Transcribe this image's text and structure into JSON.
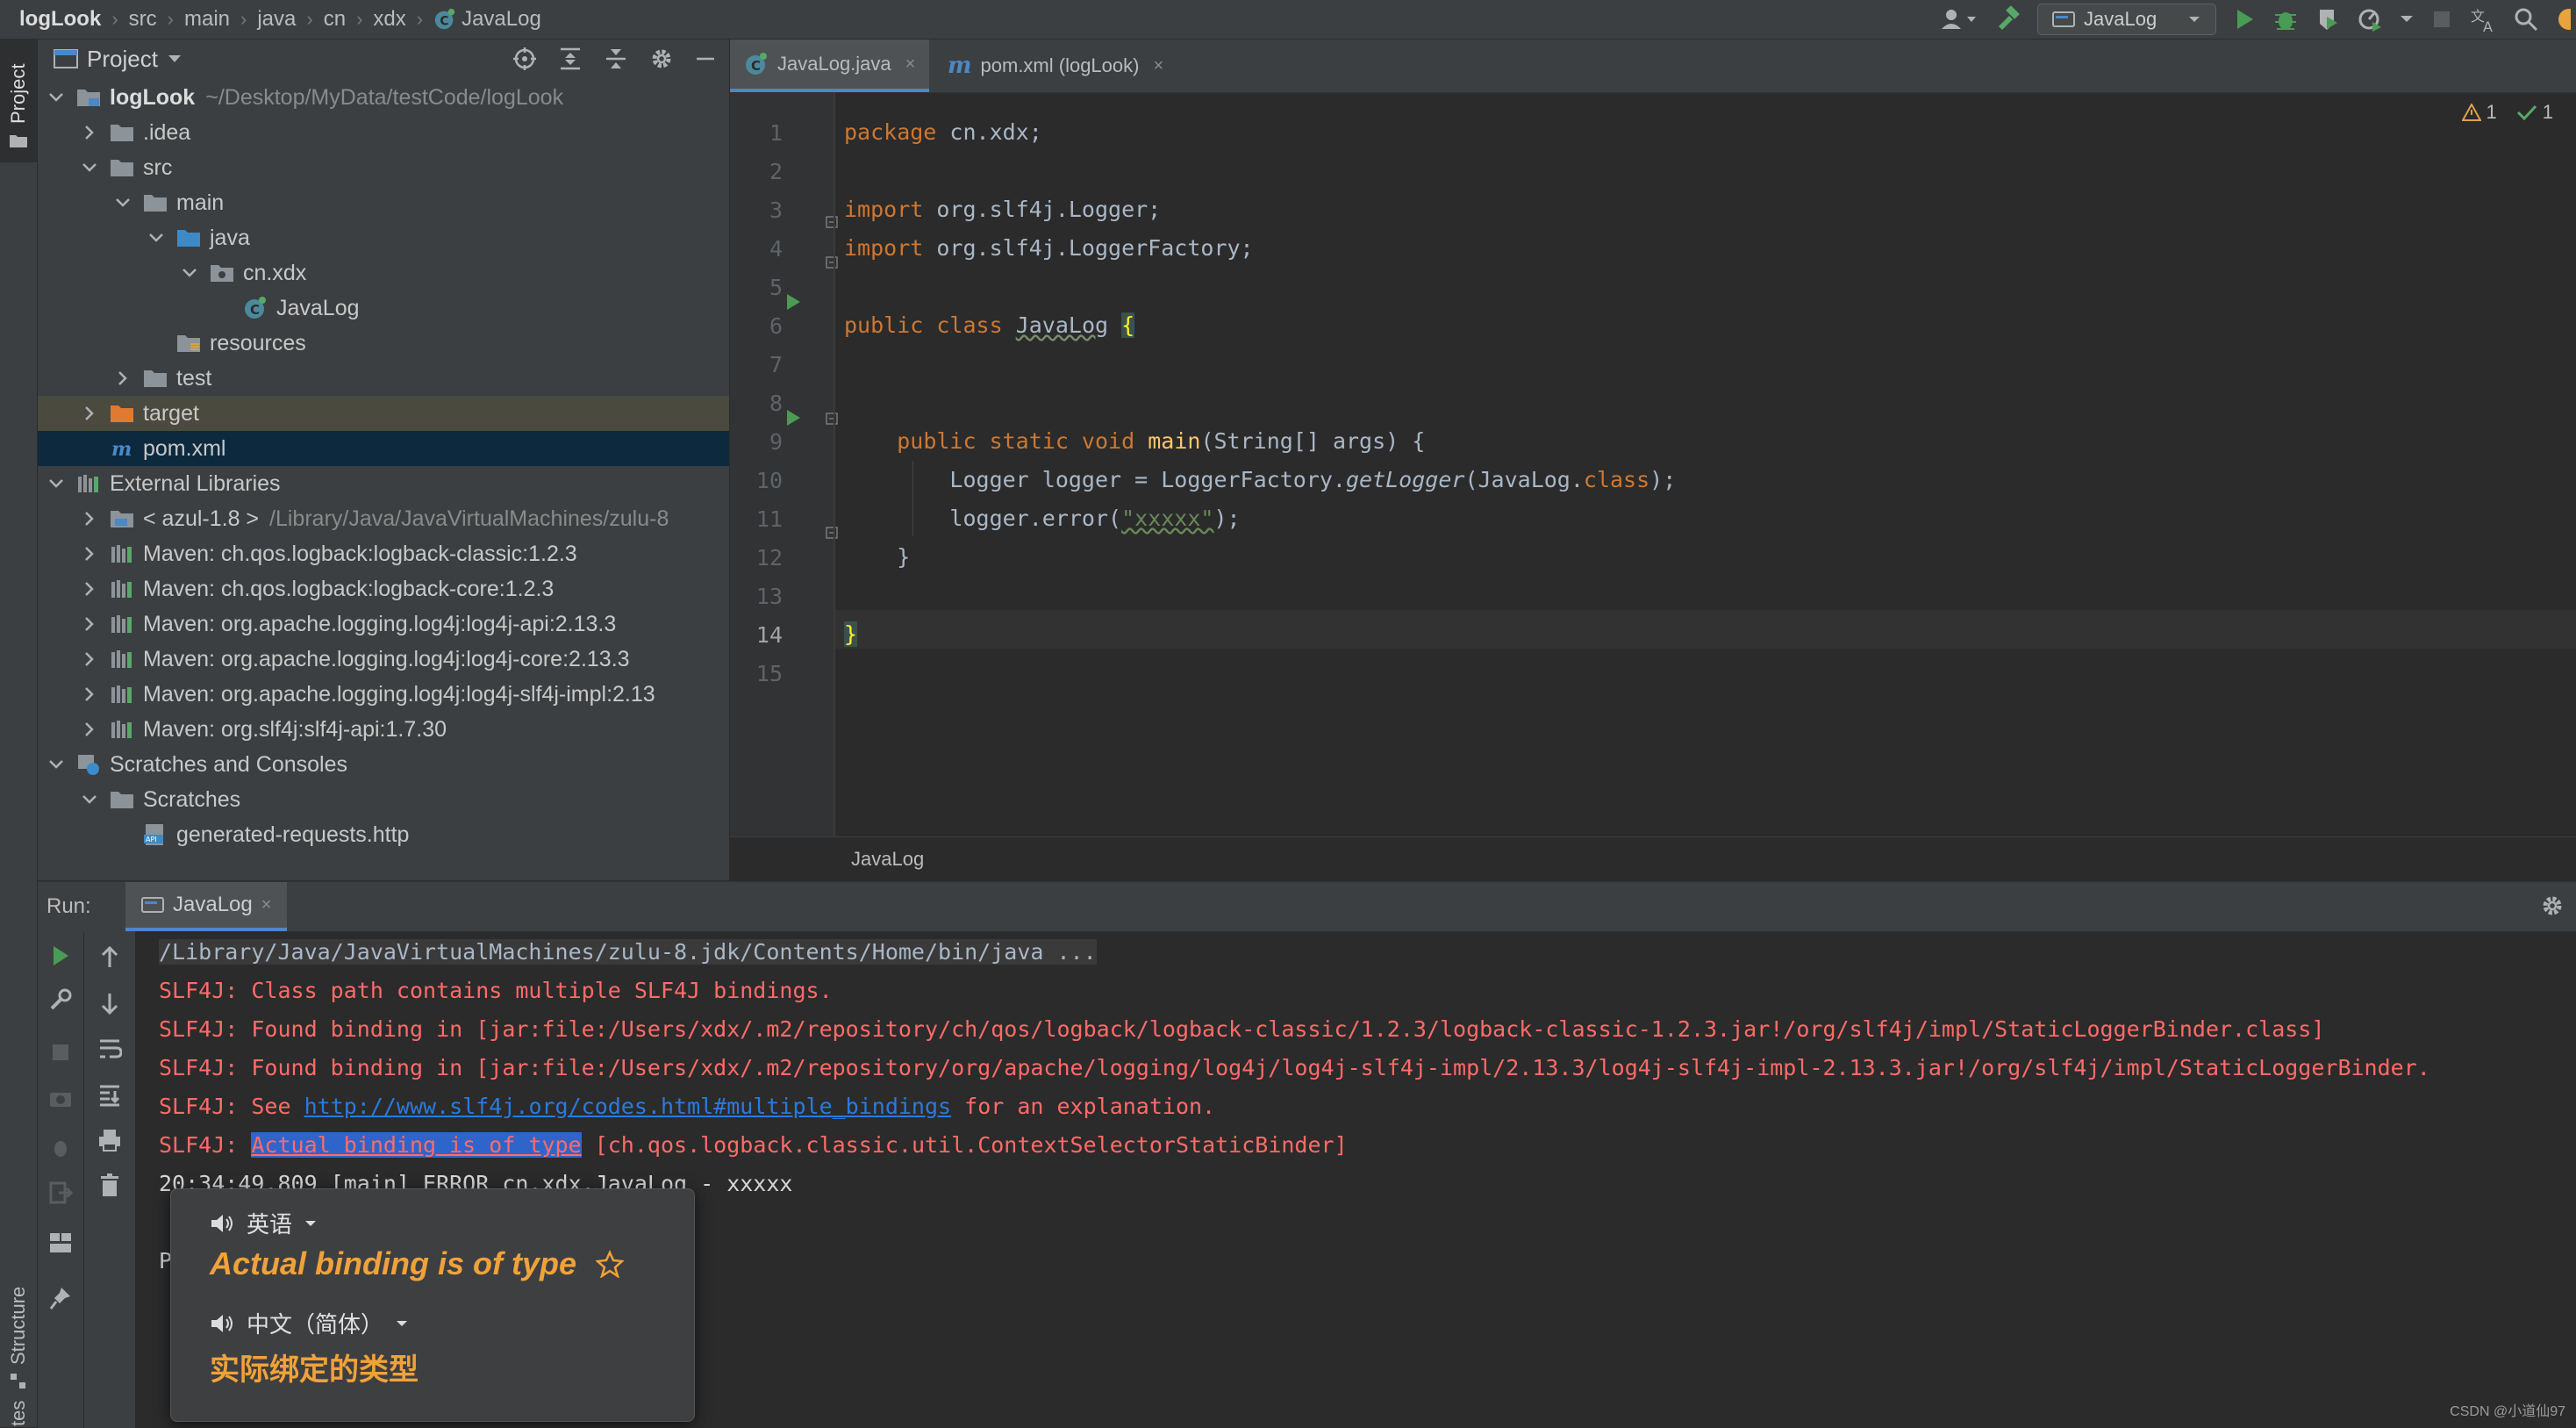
{
  "navbar": {
    "breadcrumbs": [
      "logLook",
      "src",
      "main",
      "java",
      "cn",
      "xdx",
      "JavaLog"
    ],
    "run_config": "JavaLog"
  },
  "left_stripe": {
    "project_tab": "Project",
    "structure_tab": "Structure",
    "bottom_tab": "tes"
  },
  "project_panel": {
    "title": "Project",
    "tree": [
      {
        "label": "logLook",
        "path": "~/Desktop/MyData/testCode/logLook",
        "icon": "module-folder-icon",
        "arrow": "down",
        "indent": 0,
        "bold": true
      },
      {
        "label": ".idea",
        "path": "",
        "icon": "folder-icon",
        "arrow": "right",
        "indent": 1
      },
      {
        "label": "src",
        "path": "",
        "icon": "folder-icon",
        "arrow": "down",
        "indent": 1
      },
      {
        "label": "main",
        "path": "",
        "icon": "folder-icon",
        "arrow": "down",
        "indent": 2
      },
      {
        "label": "java",
        "path": "",
        "icon": "source-folder-icon",
        "arrow": "down",
        "indent": 3
      },
      {
        "label": "cn.xdx",
        "path": "",
        "icon": "package-icon",
        "arrow": "down",
        "indent": 4
      },
      {
        "label": "JavaLog",
        "path": "",
        "icon": "java-class-icon",
        "arrow": "none",
        "indent": 5
      },
      {
        "label": "resources",
        "path": "",
        "icon": "resources-folder-icon",
        "arrow": "none",
        "indent": 3
      },
      {
        "label": "test",
        "path": "",
        "icon": "folder-icon",
        "arrow": "right",
        "indent": 2
      },
      {
        "label": "target",
        "path": "",
        "icon": "excluded-folder-icon",
        "arrow": "right",
        "indent": 1
      },
      {
        "label": "pom.xml",
        "path": "",
        "icon": "maven-icon",
        "arrow": "none",
        "indent": 1
      },
      {
        "label": "External Libraries",
        "path": "",
        "icon": "library-icon",
        "arrow": "down",
        "indent": 0
      },
      {
        "label": "< azul-1.8 >",
        "path": "/Library/Java/JavaVirtualMachines/zulu-8",
        "icon": "jdk-icon",
        "arrow": "right",
        "indent": 1
      },
      {
        "label": "Maven: ch.qos.logback:logback-classic:1.2.3",
        "path": "",
        "icon": "library-icon",
        "arrow": "right",
        "indent": 1
      },
      {
        "label": "Maven: ch.qos.logback:logback-core:1.2.3",
        "path": "",
        "icon": "library-icon",
        "arrow": "right",
        "indent": 1
      },
      {
        "label": "Maven: org.apache.logging.log4j:log4j-api:2.13.3",
        "path": "",
        "icon": "library-icon",
        "arrow": "right",
        "indent": 1
      },
      {
        "label": "Maven: org.apache.logging.log4j:log4j-core:2.13.3",
        "path": "",
        "icon": "library-icon",
        "arrow": "right",
        "indent": 1
      },
      {
        "label": "Maven: org.apache.logging.log4j:log4j-slf4j-impl:2.13",
        "path": "",
        "icon": "library-icon",
        "arrow": "right",
        "indent": 1
      },
      {
        "label": "Maven: org.slf4j:slf4j-api:1.7.30",
        "path": "",
        "icon": "library-icon",
        "arrow": "right",
        "indent": 1
      },
      {
        "label": "Scratches and Consoles",
        "path": "",
        "icon": "scratches-icon",
        "arrow": "down",
        "indent": 0
      },
      {
        "label": "Scratches",
        "path": "",
        "icon": "folder-icon",
        "arrow": "down",
        "indent": 1
      },
      {
        "label": "generated-requests.http",
        "path": "",
        "icon": "http-file-icon",
        "arrow": "none",
        "indent": 2
      }
    ]
  },
  "editor": {
    "tabs": [
      {
        "label": "JavaLog.java",
        "icon": "java-class-icon",
        "active": true
      },
      {
        "label": "pom.xml (logLook)",
        "icon": "maven-icon",
        "active": false
      }
    ],
    "close_glyph": "×",
    "warnings": "1",
    "checks": "1",
    "line_numbers": [
      "1",
      "2",
      "3",
      "4",
      "5",
      "6",
      "7",
      "8",
      "9",
      "10",
      "11",
      "12",
      "13",
      "14",
      "15"
    ],
    "code_lines": [
      "package cn.xdx;",
      "",
      "import org.slf4j.Logger;",
      "import org.slf4j.LoggerFactory;",
      "",
      "public class JavaLog {",
      "",
      "",
      "    public static void main(String[] args) {",
      "        Logger logger = LoggerFactory.getLogger(JavaLog.class);",
      "        logger.error(\"xxxxx\");",
      "    }",
      "",
      "}",
      ""
    ],
    "code_tokens": {
      "l1_kw": "package",
      "l1_rest": " cn.xdx;",
      "l3_kw": "import",
      "l3_rest": " org.slf4j.Logger;",
      "l4_kw": "import",
      "l4_rest": " org.slf4j.LoggerFactory;",
      "l6_kw": "public class",
      "l6_name": "JavaLog",
      "l6_brace": "{",
      "l9_kw": "public static void",
      "l9_fn": "main",
      "l9_rest": "(String[] args) {",
      "l10_a": "Logger logger = LoggerFactory.",
      "l10_fn": "getLogger",
      "l10_b": "(JavaLog.",
      "l10_kw": "class",
      "l10_c": ");",
      "l11_a": "logger.error(",
      "l11_str": "\"xxxxx\"",
      "l11_b": ");",
      "l12": "}",
      "l14": "}"
    },
    "bottom_breadcrumb": "JavaLog"
  },
  "run_panel": {
    "label": "Run:",
    "tab": "JavaLog",
    "console": {
      "cmd": "/Library/Java/JavaVirtualMachines/zulu-8.jdk/Contents/Home/bin/java ...",
      "l1": "SLF4J: Class path contains multiple SLF4J bindings.",
      "l2": "SLF4J: Found binding in [jar:file:/Users/xdx/.m2/repository/ch/qos/logback/logback-classic/1.2.3/logback-classic-1.2.3.jar!/org/slf4j/impl/StaticLoggerBinder.class]",
      "l3": "SLF4J: Found binding in [jar:file:/Users/xdx/.m2/repository/org/apache/logging/log4j/log4j-slf4j-impl/2.13.3/log4j-slf4j-impl-2.13.3.jar!/org/slf4j/impl/StaticLoggerBinder.",
      "l4_a": "SLF4J: See ",
      "l4_link": "http://www.slf4j.org/codes.html#multiple_bindings",
      "l4_b": " for an explanation.",
      "l5_a": "SLF4J: ",
      "l5_hl": "Actual binding is of type",
      "l5_b": " [ch.qos.logback.classic.util.ContextSelectorStaticBinder]",
      "l6": "20:34:49.809 [main] ERROR cn.xdx.JavaLog - xxxxx",
      "l8": "P"
    }
  },
  "translation_popup": {
    "source_lang": "英语",
    "word": "Actual binding is of type",
    "target_lang": "中文（简体）",
    "translation": "实际绑定的类型"
  },
  "watermark": "CSDN @小道仙97",
  "colors": {
    "keyword": "#cc7832",
    "function": "#ffc66d",
    "string": "#6a8759",
    "error_text": "#ff6b68",
    "link": "#287bde",
    "popup_accent": "#f0a23a"
  }
}
